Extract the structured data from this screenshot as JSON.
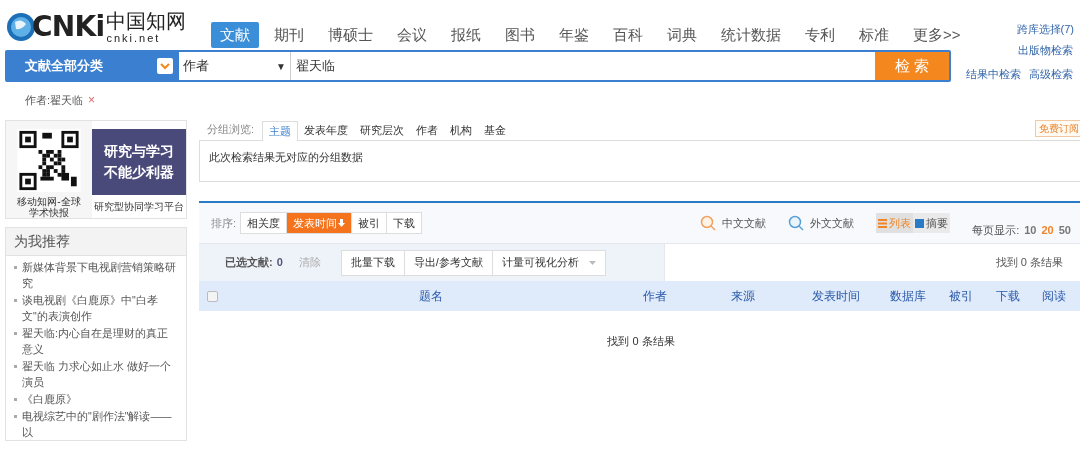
{
  "logo": {
    "letters": "CNKi",
    "chinese": "中国知网",
    "domain": "cnki.net"
  },
  "nav": [
    {
      "label": "文献",
      "selected": true
    },
    {
      "label": "期刊",
      "selected": false
    },
    {
      "label": "博硕士",
      "selected": false
    },
    {
      "label": "会议",
      "selected": false
    },
    {
      "label": "报纸",
      "selected": false
    },
    {
      "label": "图书",
      "selected": false
    },
    {
      "label": "年鉴",
      "selected": false
    },
    {
      "label": "百科",
      "selected": false
    },
    {
      "label": "词典",
      "selected": false
    },
    {
      "label": "统计数据",
      "selected": false
    },
    {
      "label": "专利",
      "selected": false
    },
    {
      "label": "标准",
      "selected": false
    },
    {
      "label": "更多>>",
      "selected": false
    }
  ],
  "right_links": [
    "跨库选择(7)",
    "出版物检索",
    "结果中检索",
    "高级检索"
  ],
  "search": {
    "category": "文献全部分类",
    "field": "作者",
    "field_caret": "▼",
    "value": "翟天临",
    "button": "检 索"
  },
  "filter": {
    "label": "作者:翟天临",
    "remove": "×"
  },
  "ad": {
    "qr_caption": "移动知网-全球学术快报",
    "banner_text": "研究与学习不能少利器",
    "banner_caption": "研究型协同学习平台"
  },
  "recommend": {
    "title": "为我推荐",
    "items": [
      "新媒体背景下电视剧营销策略研究",
      "谈电视剧《白鹿原》中\"白孝文\"的表演创作",
      "翟天临:内心自在是理财的真正意义",
      "翟天临 力求心如止水 做好一个演员",
      "《白鹿原》",
      "电视综艺中的\"剧作法\"解读——以"
    ]
  },
  "group": {
    "label": "分组浏览:",
    "tabs": [
      {
        "label": "主题",
        "selected": true
      },
      {
        "label": "发表年度",
        "selected": false
      },
      {
        "label": "研究层次",
        "selected": false
      },
      {
        "label": "作者",
        "selected": false
      },
      {
        "label": "机构",
        "selected": false
      },
      {
        "label": "基金",
        "selected": false
      }
    ],
    "subscribe": "免费订阅",
    "message": "此次检索结果无对应的分组数据"
  },
  "sort": {
    "label": "排序:",
    "options": [
      {
        "label": "相关度",
        "selected": false
      },
      {
        "label": "发表时间",
        "selected": true
      },
      {
        "label": "被引",
        "selected": false
      },
      {
        "label": "下载",
        "selected": false
      }
    ],
    "chinese_docs": "中文文献",
    "foreign_docs": "外文文献",
    "views": [
      {
        "label": "列表",
        "selected": true
      },
      {
        "label": "摘要",
        "selected": false
      }
    ],
    "per_page_label": "每页显示:",
    "per_page": [
      {
        "label": "10",
        "selected": false
      },
      {
        "label": "20",
        "selected": true
      },
      {
        "label": "50",
        "selected": false
      }
    ]
  },
  "toolbar": {
    "selected_label": "已选文献:",
    "selected_count": "0",
    "clear": "清除",
    "buttons": [
      "批量下载",
      "导出/参考文献",
      "计量可视化分析"
    ],
    "found": "找到 0 条结果"
  },
  "table": {
    "checked": false,
    "columns": [
      "题名",
      "作者",
      "来源",
      "发表时间",
      "数据库",
      "被引",
      "下载",
      "阅读"
    ]
  },
  "empty_message": "找到 0 条结果"
}
